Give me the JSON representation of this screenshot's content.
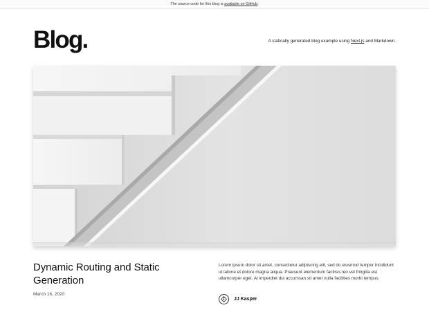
{
  "banner": {
    "prefix": "The source code for this blog is",
    "link_text": "available on GitHub",
    "suffix": "."
  },
  "header": {
    "logo": "Blog.",
    "tagline_prefix": "A statically generated blog example using",
    "tagline_link": "Next.js",
    "tagline_suffix": "and Markdown."
  },
  "hero_post": {
    "cover_image_icon": "staircase-photo",
    "title": "Dynamic Routing and Static Generation",
    "date": "March 16, 2020",
    "excerpt": "Lorem ipsum dolor sit amet, consectetur adipiscing elit, sed do eiusmod tempor incididunt ut labore et dolore magna aliqua. Praesent elementum facilisis leo vel fringilla est ullamcorper eget. At imperdiet dui accumsan sit amet nulla facilities morbi tempus.",
    "author": {
      "name": "JJ Kasper",
      "avatar_icon": "jj-kasper-avatar"
    }
  }
}
